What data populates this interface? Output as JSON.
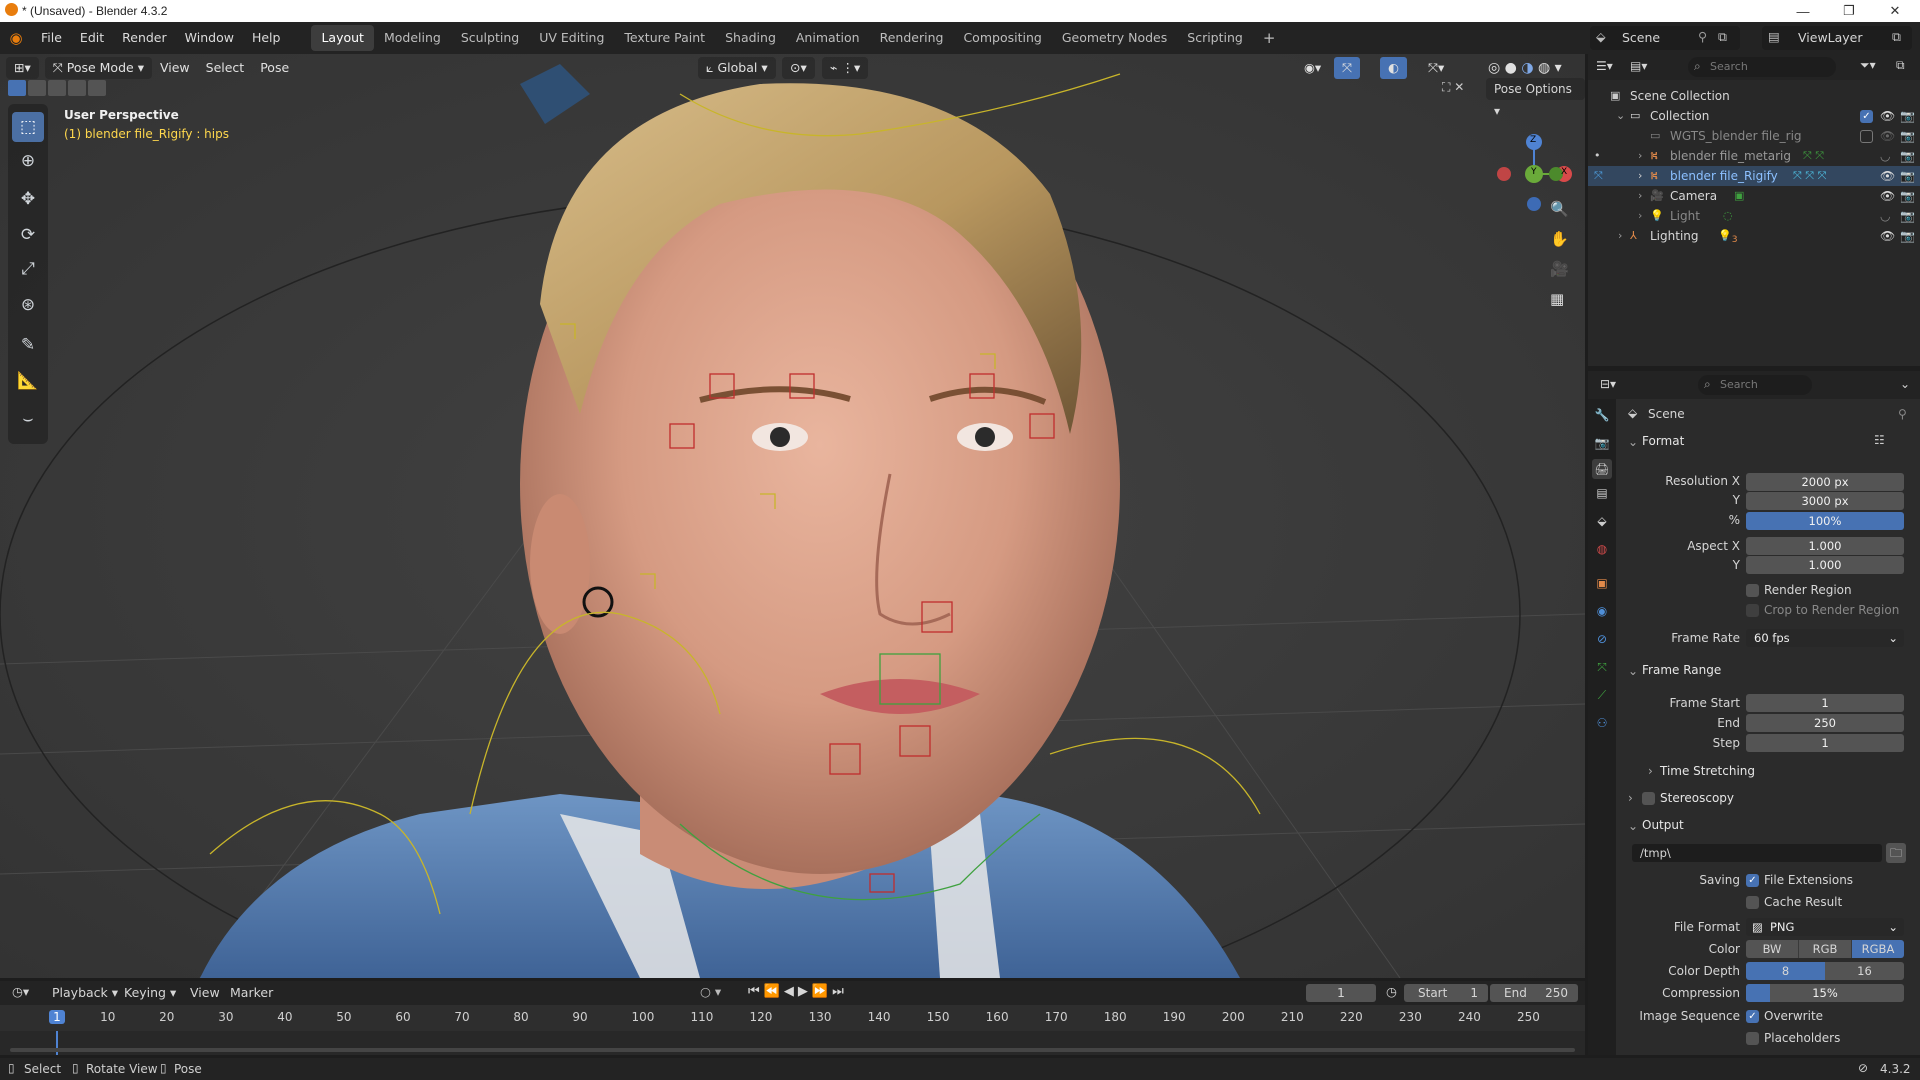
{
  "window": {
    "title": "* (Unsaved) - Blender 4.3.2"
  },
  "menu": [
    "File",
    "Edit",
    "Render",
    "Window",
    "Help"
  ],
  "workspaces": [
    "Layout",
    "Modeling",
    "Sculpting",
    "UV Editing",
    "Texture Paint",
    "Shading",
    "Animation",
    "Rendering",
    "Compositing",
    "Geometry Nodes",
    "Scripting"
  ],
  "active_workspace": "Layout",
  "scene_name": "Scene",
  "view_layer": "ViewLayer",
  "viewport": {
    "mode": "Pose Mode",
    "menus": [
      "View",
      "Select",
      "Pose"
    ],
    "orientation": "Global",
    "pose_options": "Pose Options",
    "overlay_title": "User Perspective",
    "overlay_sub": "(1) blender file_Rigify : hips",
    "gizmo": {
      "x": "X",
      "y": "Y",
      "z": "Z"
    }
  },
  "outliner": {
    "search_placeholder": "Search",
    "items": [
      {
        "label": "Scene Collection"
      },
      {
        "label": "Collection"
      },
      {
        "label": "WGTS_blender file_rig"
      },
      {
        "label": "blender file_metarig"
      },
      {
        "label": "blender file_Rigify"
      },
      {
        "label": "Camera"
      },
      {
        "label": "Light"
      },
      {
        "label": "Lighting"
      }
    ],
    "lighting_count": "3"
  },
  "properties": {
    "search_placeholder": "Search",
    "context": "Scene",
    "format": {
      "title": "Format",
      "resolution_x_label": "Resolution X",
      "resolution_x": "2000 px",
      "y_label": "Y",
      "resolution_y": "3000 px",
      "pct_label": "%",
      "resolution_pct": "100%",
      "aspect_x_label": "Aspect X",
      "aspect_x": "1.000",
      "aspect_y_label": "Y",
      "aspect_y": "1.000",
      "render_region": "Render Region",
      "crop": "Crop to Render Region",
      "frame_rate_label": "Frame Rate",
      "frame_rate": "60 fps"
    },
    "frame_range": {
      "title": "Frame Range",
      "start_label": "Frame Start",
      "start": "1",
      "end_label": "End",
      "end": "250",
      "step_label": "Step",
      "step": "1",
      "time_stretching": "Time Stretching"
    },
    "stereoscopy": "Stereoscopy",
    "output": {
      "title": "Output",
      "path": "/tmp\\",
      "saving_label": "Saving",
      "file_extensions": "File Extensions",
      "cache_result": "Cache Result",
      "file_format_label": "File Format",
      "file_format": "PNG",
      "color_label": "Color",
      "color_options": [
        "BW",
        "RGB",
        "RGBA"
      ],
      "color_selected": "RGBA",
      "depth_label": "Color Depth",
      "depth_options": [
        "8",
        "16"
      ],
      "depth_selected": "8",
      "compression_label": "Compression",
      "compression": "15%",
      "compression_value": 15,
      "image_seq_label": "Image Sequence",
      "overwrite": "Overwrite",
      "placeholders": "Placeholders"
    }
  },
  "timeline": {
    "menus": [
      "Playback",
      "Keying",
      "View",
      "Marker"
    ],
    "current_frame": "1",
    "start_label": "Start",
    "start": "1",
    "end_label": "End",
    "end": "250",
    "ticks": [
      "1",
      "10",
      "20",
      "30",
      "40",
      "50",
      "60",
      "70",
      "80",
      "90",
      "100",
      "110",
      "120",
      "130",
      "140",
      "150",
      "160",
      "170",
      "180",
      "190",
      "200",
      "210",
      "220",
      "230",
      "240",
      "250"
    ]
  },
  "statusbar": {
    "select": "Select",
    "rotate": "Rotate View",
    "pose": "Pose",
    "version": "4.3.2"
  },
  "colors": {
    "accent": "#4772b3",
    "header": "#232323",
    "panel": "#2b2b2b",
    "viewport": "#3b3b3b"
  }
}
